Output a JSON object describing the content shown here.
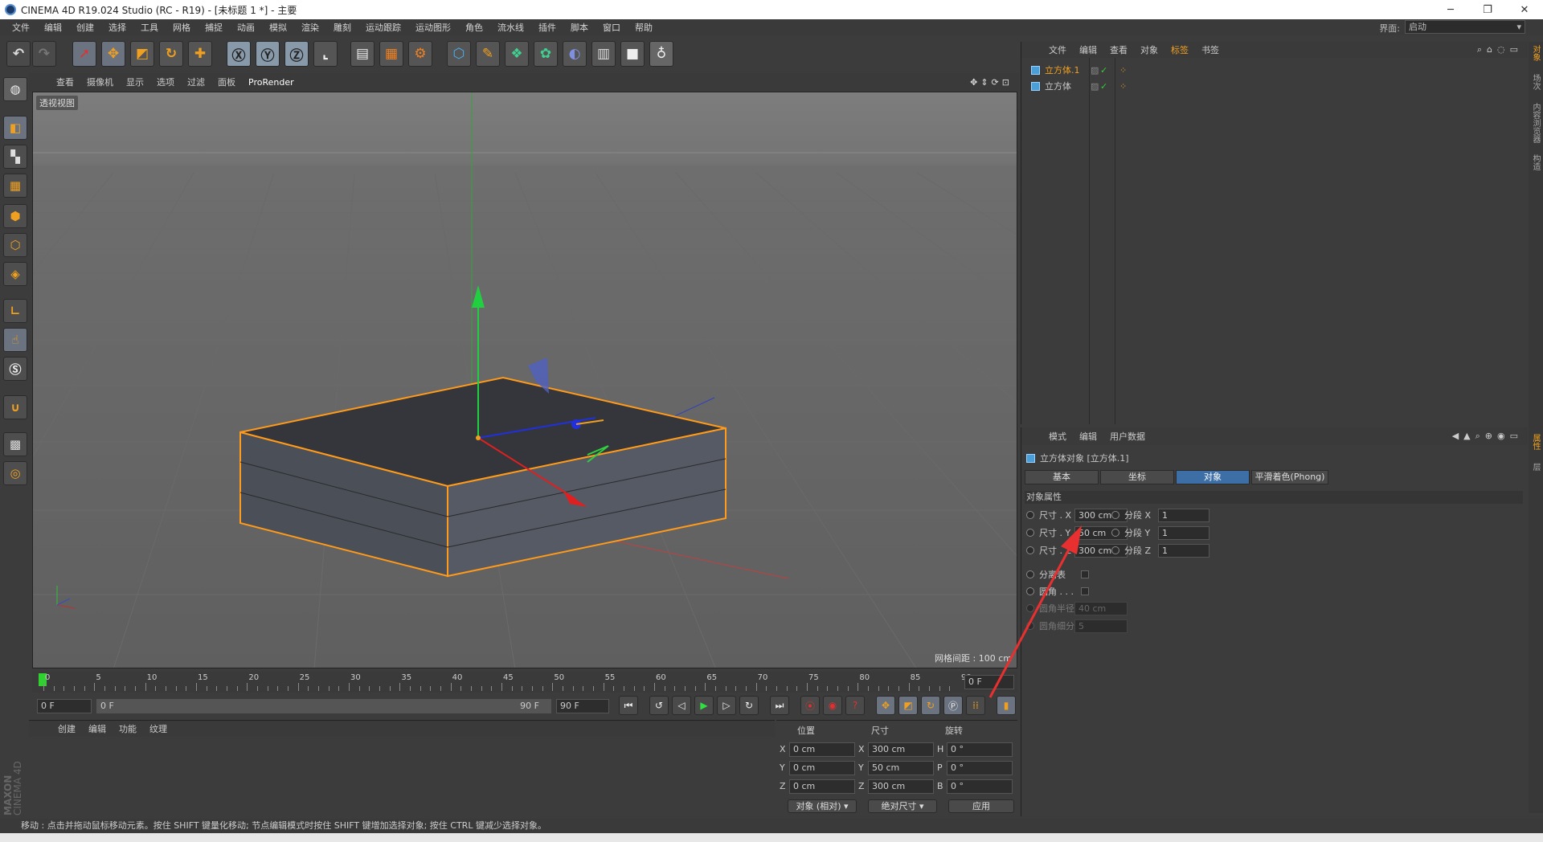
{
  "window": {
    "title": "CINEMA 4D R19.024 Studio (RC - R19) - [未标题 1 *] - 主要"
  },
  "menubar": [
    "文件",
    "编辑",
    "创建",
    "选择",
    "工具",
    "网格",
    "捕捉",
    "动画",
    "模拟",
    "渲染",
    "雕刻",
    "运动跟踪",
    "运动图形",
    "角色",
    "流水线",
    "插件",
    "脚本",
    "窗口",
    "帮助"
  ],
  "layout": {
    "label": "界面:",
    "value": "启动"
  },
  "viewport": {
    "menu": [
      "查看",
      "摄像机",
      "显示",
      "选项",
      "过滤",
      "面板",
      "ProRender"
    ],
    "view_name": "透视视图",
    "grid_spacing": "网格间距 : 100 cm"
  },
  "timeline": {
    "ticks": [
      "0",
      "5",
      "10",
      "15",
      "20",
      "25",
      "30",
      "35",
      "40",
      "45",
      "50",
      "55",
      "60",
      "65",
      "70",
      "75",
      "80",
      "85",
      "90"
    ],
    "current_frame": "0 F",
    "start_field": "0 F",
    "range_start": "0 F",
    "range_end": "90 F",
    "end_field": "90 F"
  },
  "material": {
    "menu": [
      "创建",
      "编辑",
      "功能",
      "纹理"
    ],
    "brand_line1": "MAXON",
    "brand_line2": "CINEMA 4D"
  },
  "coords": {
    "headers": {
      "position": "位置",
      "size": "尺寸",
      "rotation": "旋转"
    },
    "rows": [
      {
        "axis": "X",
        "pos": "0 cm",
        "saxis": "X",
        "size": "300 cm",
        "raxis": "H",
        "rot": "0 °"
      },
      {
        "axis": "Y",
        "pos": "0 cm",
        "saxis": "Y",
        "size": "50 cm",
        "raxis": "P",
        "rot": "0 °"
      },
      {
        "axis": "Z",
        "pos": "0 cm",
        "saxis": "Z",
        "size": "300 cm",
        "raxis": "B",
        "rot": "0 °"
      }
    ],
    "mode_dropdown": "对象 (相对)",
    "size_dropdown": "绝对尺寸",
    "apply_button": "应用"
  },
  "objects": {
    "menu": [
      "文件",
      "编辑",
      "查看",
      "对象",
      "标签",
      "书签"
    ],
    "items": [
      {
        "name": "立方体.1",
        "selected": true
      },
      {
        "name": "立方体",
        "selected": false
      }
    ]
  },
  "attributes": {
    "menu": [
      "模式",
      "编辑",
      "用户数据"
    ],
    "object_title": "立方体对象 [立方体.1]",
    "tabs": [
      "基本",
      "坐标",
      "对象",
      "平滑着色(Phong)"
    ],
    "active_tab": "对象",
    "section": "对象属性",
    "size_x_label": "尺寸 . X",
    "size_x": "300 cm",
    "size_y_label": "尺寸 . Y",
    "size_y": "50 cm",
    "size_z_label": "尺寸 . Z",
    "size_z": "300 cm",
    "seg_x_label": "分段 X",
    "seg_x": "1",
    "seg_y_label": "分段 Y",
    "seg_y": "1",
    "seg_z_label": "分段 Z",
    "seg_z": "1",
    "separate_label": "分离表",
    "fillet_label": "圆角 . . .",
    "fillet_radius_label": "圆角半径",
    "fillet_radius": "40 cm",
    "fillet_sub_label": "圆角细分",
    "fillet_sub": "5"
  },
  "side_tabs": [
    "对象",
    "场次",
    "内容浏览器",
    "构造",
    "属性",
    "层"
  ],
  "status": "移动 : 点击并拖动鼠标移动元素。按住 SHIFT 键量化移动; 节点编辑模式时按住 SHIFT 键增加选择对象; 按住 CTRL 键减少选择对象。",
  "colors": {
    "accent": "#3d6fa6",
    "selection": "#ff9a1a",
    "annotation_arrow": "#e83030"
  }
}
